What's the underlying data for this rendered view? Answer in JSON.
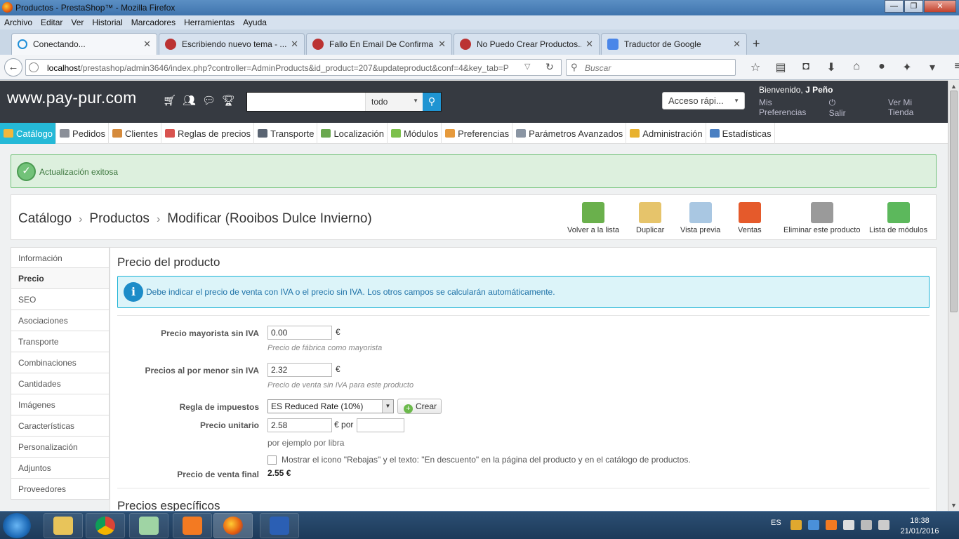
{
  "window": {
    "title": "Productos - PrestaShop™ - Mozilla Firefox",
    "controls": [
      "—",
      "❐",
      "✕"
    ]
  },
  "menubar": [
    "Archivo",
    "Editar",
    "Ver",
    "Historial",
    "Marcadores",
    "Herramientas",
    "Ayuda"
  ],
  "tabs": [
    {
      "label": "Conectando...",
      "active": true
    },
    {
      "label": "Escribiendo nuevo tema - ...",
      "active": false
    },
    {
      "label": "Fallo En Email De Confirma...",
      "active": false
    },
    {
      "label": "No Puedo Crear Productos...",
      "active": false
    },
    {
      "label": "Traductor de Google",
      "active": false
    }
  ],
  "new_tab_label": "+",
  "navbar": {
    "url_host": "localhost",
    "url_rest": "/prestashop/admin3646/index.php?controller=AdminProducts&id_product=207&updateproduct&conf=4&key_tab=P",
    "search_placeholder": "Buscar"
  },
  "ps": {
    "logo": "www.pay-pur.com",
    "search_scope": "todo",
    "quick_access": "Acceso rápi...",
    "welcome_prefix": "Bienvenido,",
    "welcome_user": "J Peño",
    "prefs_link": "Mis Preferencias",
    "logout_link": "Salir",
    "store_link": "Ver Mi Tienda"
  },
  "mainnav": [
    {
      "label": "Catálogo",
      "active": true,
      "color": "#f0b73b"
    },
    {
      "label": "Pedidos",
      "active": false,
      "color": "#8a8f98"
    },
    {
      "label": "Clientes",
      "active": false,
      "color": "#d58a3b"
    },
    {
      "label": "Reglas de precios",
      "active": false,
      "color": "#d9534f"
    },
    {
      "label": "Transporte",
      "active": false,
      "color": "#5a6472"
    },
    {
      "label": "Localización",
      "active": false,
      "color": "#6aa84f"
    },
    {
      "label": "Módulos",
      "active": false,
      "color": "#7cc04b"
    },
    {
      "label": "Preferencias",
      "active": false,
      "color": "#e69a3c"
    },
    {
      "label": "Parámetros Avanzados",
      "active": false,
      "color": "#8a95a3"
    },
    {
      "label": "Administración",
      "active": false,
      "color": "#e8b12e"
    },
    {
      "label": "Estadísticas",
      "active": false,
      "color": "#4a7fc2"
    }
  ],
  "alert_text": "Actualización exitosa",
  "breadcrumb": {
    "l1": "Catálogo",
    "l2": "Productos",
    "l3": "Modificar (Rooibos Dulce Invierno)"
  },
  "toolbar": [
    {
      "label": "Volver a la lista",
      "icon": "back-arrow-icon",
      "color": "#6ab04c"
    },
    {
      "label": "Duplicar",
      "icon": "duplicate-icon",
      "color": "#e6c46b"
    },
    {
      "label": "Vista previa",
      "icon": "preview-icon",
      "color": "#a9c7e2"
    },
    {
      "label": "Ventas",
      "icon": "sales-chart-icon",
      "color": "#e55a2b"
    },
    {
      "label": "Eliminar este producto",
      "icon": "trash-icon",
      "color": "#9a9a9a"
    },
    {
      "label": "Lista de módulos",
      "icon": "puzzle-icon",
      "color": "#5cb85c"
    }
  ],
  "sidetabs": [
    "Información",
    "Precio",
    "SEO",
    "Asociaciones",
    "Transporte",
    "Combinaciones",
    "Cantidades",
    "Imágenes",
    "Características",
    "Personalización",
    "Adjuntos",
    "Proveedores"
  ],
  "sidetab_active": "Precio",
  "form": {
    "title": "Precio del producto",
    "info": "Debe indicar el precio de venta con IVA o el precio sin IVA. Los otros campos se calcularán automáticamente.",
    "wholesale_label": "Precio mayorista sin IVA",
    "wholesale_value": "0.00",
    "wholesale_help": "Precio de fábrica como mayorista",
    "retail_label": "Precios al por menor sin IVA",
    "retail_value": "2.32",
    "retail_help": "Precio de venta sin IVA para este producto",
    "tax_label": "Regla de impuestos",
    "tax_value": "ES Reduced Rate (10%)",
    "create_btn": "Crear",
    "unit_label": "Precio unitario",
    "unit_value": "2.58",
    "unit_per": "por",
    "unit_per_value": "",
    "unit_help": "por ejemplo por libra",
    "onsale_label": "Mostrar el icono \"Rebajas\" y el texto: \"En descuento\" en la página del producto y en el catálogo de productos.",
    "final_label": "Precio de venta final",
    "final_value": "2.55 €",
    "currency": "€",
    "specific_title": "Precios específicos"
  },
  "taskbar": {
    "lang": "ES",
    "time": "18:38",
    "date": "21/01/2016"
  }
}
